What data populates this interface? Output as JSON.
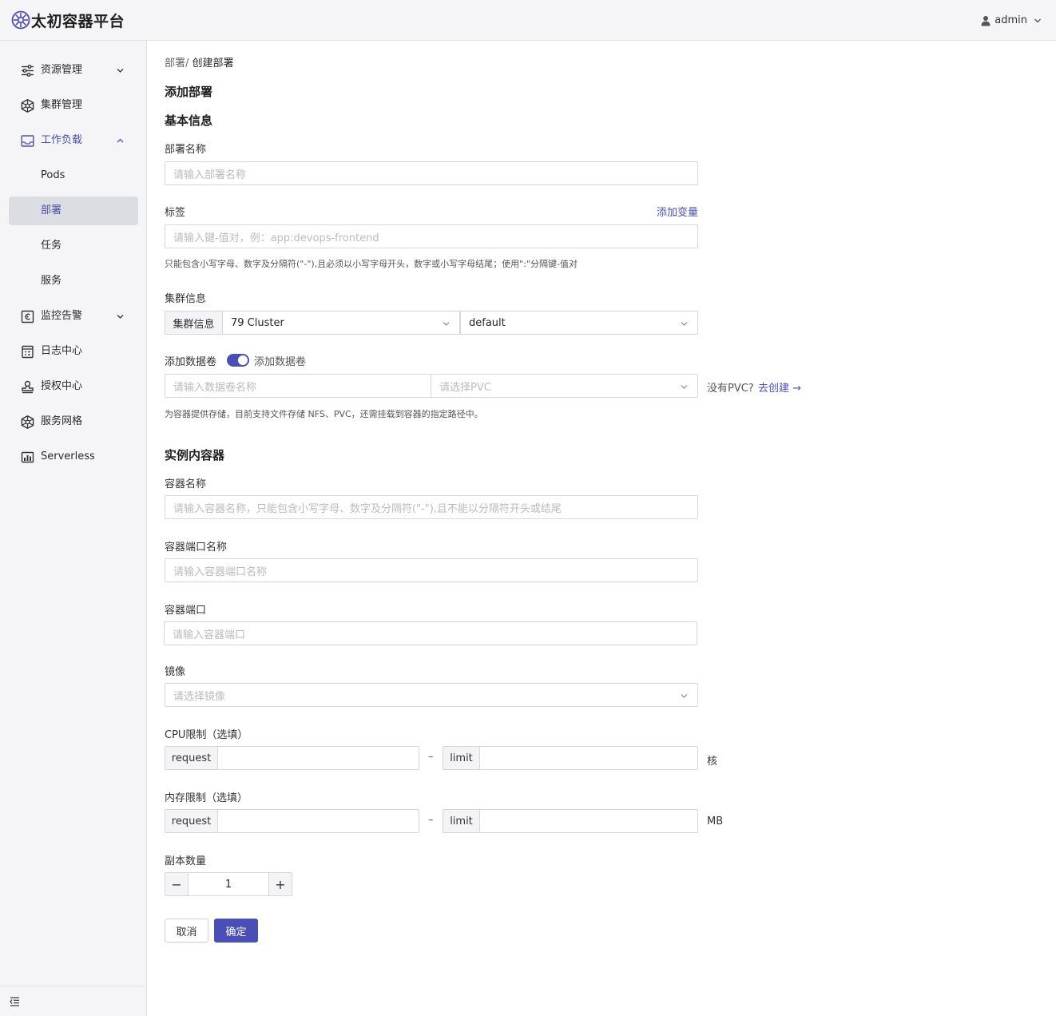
{
  "header": {
    "app_title": "太初容器平台",
    "user_name": "admin"
  },
  "sidebar": {
    "items": [
      {
        "label": "资源管理",
        "icon": "sliders-icon"
      },
      {
        "label": "集群管理",
        "icon": "cluster-icon"
      },
      {
        "label": "工作负载",
        "icon": "inbox-icon"
      },
      {
        "label": "Pods"
      },
      {
        "label": "部署"
      },
      {
        "label": "任务"
      },
      {
        "label": "服务"
      },
      {
        "label": "监控告警",
        "icon": "monitor-icon"
      },
      {
        "label": "日志中心",
        "icon": "log-icon"
      },
      {
        "label": "授权中心",
        "icon": "stamp-icon"
      },
      {
        "label": "服务网格",
        "icon": "mesh-icon"
      },
      {
        "label": "Serverless",
        "icon": "serverless-icon"
      }
    ]
  },
  "breadcrumb": {
    "parent": "部署/",
    "current": "创建部署"
  },
  "form": {
    "page_title": "添加部署",
    "section_basic": "基本信息",
    "name_label": "部署名称",
    "name_placeholder": "请输入部署名称",
    "tags_label": "标签",
    "add_var_link": "添加变量",
    "tags_placeholder": "请输入键-值对，例：app:devops-frontend",
    "tags_hint": "只能包含小写字母、数字及分隔符(\"-\"),且必须以小写字母开头，数字或小写字母结尾；使用\":\"分隔键-值对",
    "cluster_label": "集群信息",
    "cluster_addon": "集群信息",
    "cluster_value": "79 Cluster",
    "namespace_value": "default",
    "volume_label": "添加数据卷",
    "volume_toggle_text": "添加数据卷",
    "volume_name_placeholder": "请输入数据卷名称",
    "pvc_placeholder": "请选择PVC",
    "no_pvc_text": "没有PVC?",
    "create_pvc_link": "去创建 →",
    "volume_hint": "为容器提供存储，目前支持文件存储 NFS、PVC，还需挂载到容器的指定路径中。",
    "section_container": "实例内容器",
    "container_name_label": "容器名称",
    "container_name_placeholder": "请输入容器名称，只能包含小写字母、数字及分隔符(\"-\"),且不能以分隔符开头或结尾",
    "port_name_label": "容器端口名称",
    "port_name_placeholder": "请输入容器端口名称",
    "port_label": "容器端口",
    "port_placeholder": "请输入容器端口",
    "image_label": "镜像",
    "image_placeholder": "请选择镜像",
    "cpu_label": "CPU限制（选填）",
    "request_addon": "request",
    "limit_addon": "limit",
    "range_sep": "–",
    "cpu_unit": "核",
    "mem_label": "内存限制（选填）",
    "mem_unit": "MB",
    "replicas_label": "副本数量",
    "replicas_value": "1",
    "minus": "−",
    "plus": "+",
    "cancel_label": "取消",
    "confirm_label": "确定"
  },
  "colors": {
    "accent": "#4a4fb5",
    "sidebar_bg": "#f5f5f7",
    "selected_bg": "#dcdce3"
  }
}
